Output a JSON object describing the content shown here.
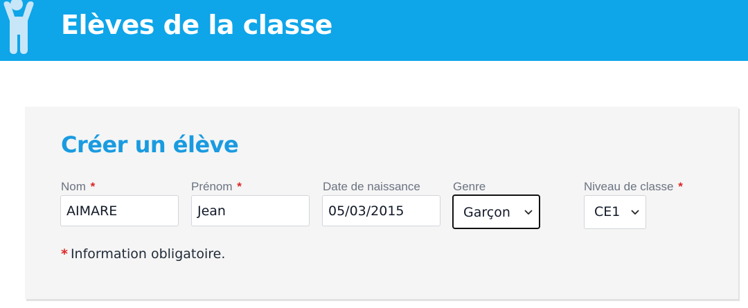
{
  "header": {
    "title": "Elèves de la classe",
    "icon": "child-figure-icon",
    "background": "#0ea5e9"
  },
  "form": {
    "title": "Créer un élève",
    "required_marker": "*",
    "fields": {
      "nom": {
        "label": "Nom",
        "value": "AIMARE",
        "required": true
      },
      "prenom": {
        "label": "Prénom",
        "value": "Jean",
        "required": true
      },
      "date_naissance": {
        "label": "Date de naissance",
        "value": "05/03/2015",
        "required": false
      },
      "genre": {
        "label": "Genre",
        "value": "Garçon",
        "required": false
      },
      "niveau": {
        "label": "Niveau de classe",
        "value": "CE1",
        "required": true
      }
    },
    "note": "Information obligatoire."
  },
  "colors": {
    "accent": "#1a9be0",
    "required": "#dc2626",
    "card_background": "#f5f5f5"
  }
}
